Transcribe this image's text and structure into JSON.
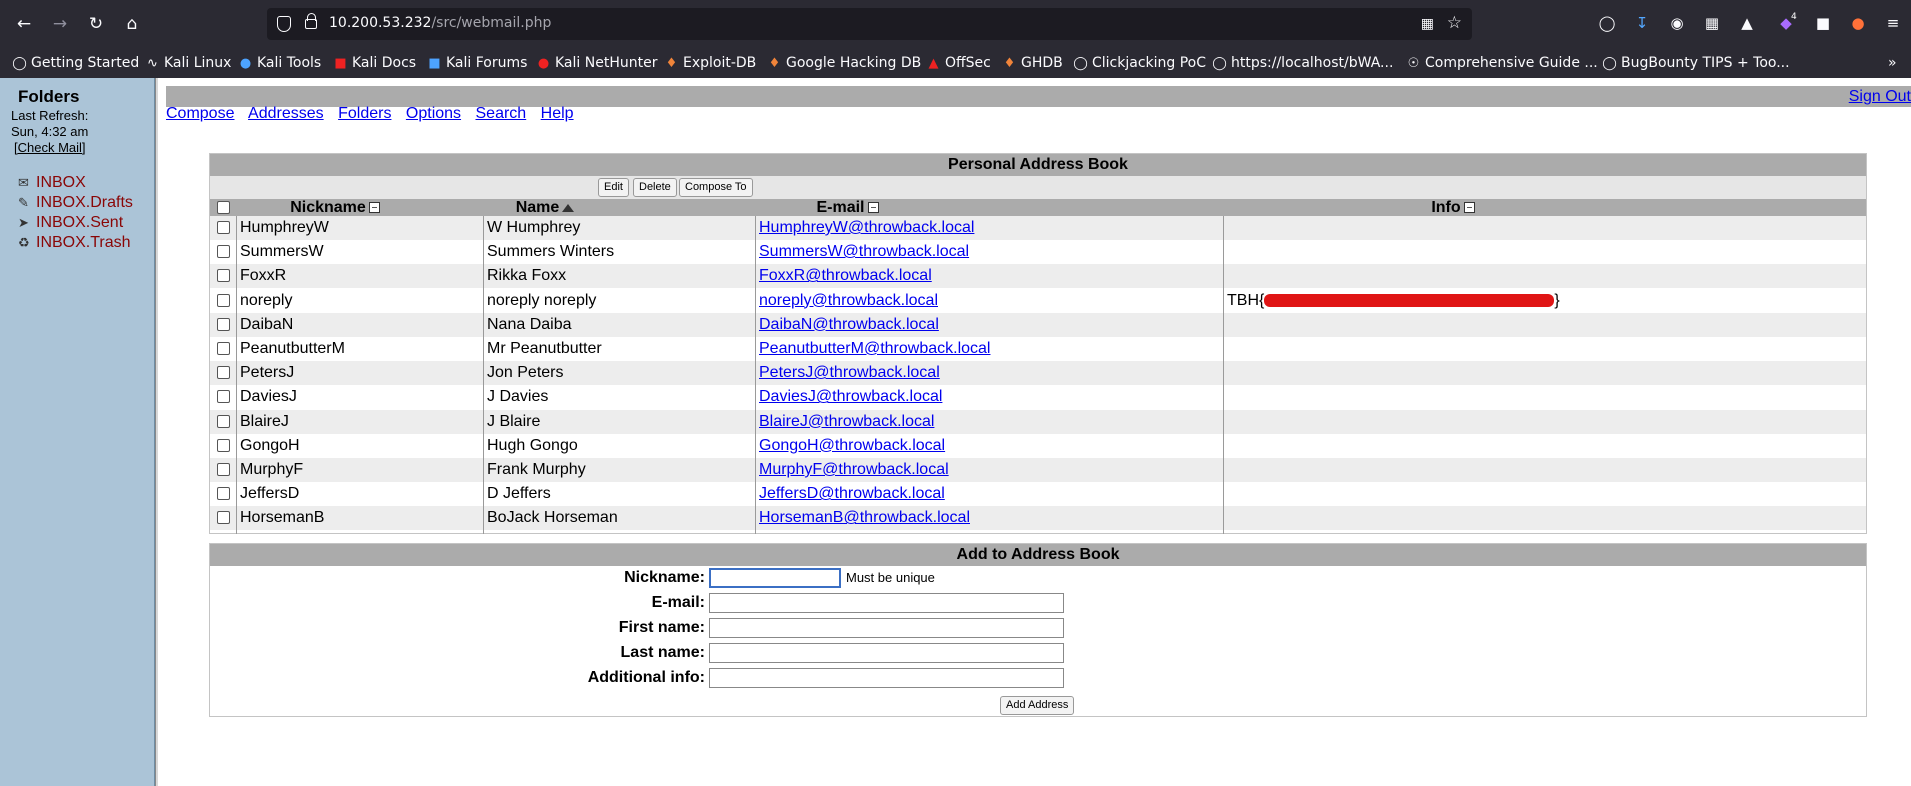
{
  "browser": {
    "url_host": "10.200.53.232",
    "url_path": "/src/webmail.php",
    "extension_badge": "4",
    "bookmarks": [
      {
        "label": "Getting Started",
        "icon": "globe-icon"
      },
      {
        "label": "Kali Linux",
        "icon": "kali-icon"
      },
      {
        "label": "Kali Tools",
        "icon": "kali-tools-icon"
      },
      {
        "label": "Kali Docs",
        "icon": "kali-docs-icon"
      },
      {
        "label": "Kali Forums",
        "icon": "kali-forums-icon"
      },
      {
        "label": "Kali NetHunter",
        "icon": "nethunter-icon"
      },
      {
        "label": "Exploit-DB",
        "icon": "exploitdb-icon"
      },
      {
        "label": "Google Hacking DB",
        "icon": "ghdb-icon"
      },
      {
        "label": "OffSec",
        "icon": "offsec-icon"
      },
      {
        "label": "GHDB",
        "icon": "ghdb-icon"
      },
      {
        "label": "Clickjacking PoC",
        "icon": "globe-icon"
      },
      {
        "label": "https://localhost/bWA...",
        "icon": "globe-icon"
      },
      {
        "label": "Comprehensive Guide ...",
        "icon": "wordpress-icon"
      },
      {
        "label": "BugBounty TIPS + Too...",
        "icon": "globe-icon"
      }
    ]
  },
  "sidebar": {
    "title": "Folders",
    "last_refresh_label": "Last Refresh:",
    "last_refresh_time": "Sun, 4:32 am",
    "check_mail": "[Check Mail]",
    "folders": [
      {
        "label": "INBOX",
        "icon": "inbox-icon"
      },
      {
        "label": "INBOX.Drafts",
        "icon": "drafts-icon"
      },
      {
        "label": "INBOX.Sent",
        "icon": "sent-icon"
      },
      {
        "label": "INBOX.Trash",
        "icon": "trash-icon"
      }
    ]
  },
  "header": {
    "sign_out": "Sign Out",
    "menu": [
      "Compose",
      "Addresses",
      "Folders",
      "Options",
      "Search",
      "Help"
    ]
  },
  "address_book": {
    "title": "Personal Address Book",
    "actions": [
      "Edit",
      "Delete",
      "Compose To"
    ],
    "columns": [
      "Nickname",
      "Name",
      "E-mail",
      "Info"
    ],
    "rows": [
      {
        "nickname": "HumphreyW",
        "name": "W Humphrey",
        "email": "HumphreyW@throwback.local",
        "info": ""
      },
      {
        "nickname": "SummersW",
        "name": "Summers Winters",
        "email": "SummersW@throwback.local",
        "info": ""
      },
      {
        "nickname": "FoxxR",
        "name": "Rikka Foxx",
        "email": "FoxxR@throwback.local",
        "info": ""
      },
      {
        "nickname": "noreply",
        "name": "noreply noreply",
        "email": "noreply@throwback.local",
        "info": "TBH{",
        "info_end": "}"
      },
      {
        "nickname": "DaibaN",
        "name": "Nana Daiba",
        "email": "DaibaN@throwback.local",
        "info": ""
      },
      {
        "nickname": "PeanutbutterM",
        "name": "Mr Peanutbutter",
        "email": "PeanutbutterM@throwback.local",
        "info": ""
      },
      {
        "nickname": "PetersJ",
        "name": "Jon Peters",
        "email": "PetersJ@throwback.local",
        "info": ""
      },
      {
        "nickname": "DaviesJ",
        "name": "J Davies",
        "email": "DaviesJ@throwback.local",
        "info": ""
      },
      {
        "nickname": "BlaireJ",
        "name": "J Blaire",
        "email": "BlaireJ@throwback.local",
        "info": ""
      },
      {
        "nickname": "GongoH",
        "name": "Hugh Gongo",
        "email": "GongoH@throwback.local",
        "info": ""
      },
      {
        "nickname": "MurphyF",
        "name": "Frank Murphy",
        "email": "MurphyF@throwback.local",
        "info": ""
      },
      {
        "nickname": "JeffersD",
        "name": "D Jeffers",
        "email": "JeffersD@throwback.local",
        "info": ""
      },
      {
        "nickname": "HorsemanB",
        "name": "BoJack Horseman",
        "email": "HorsemanB@throwback.local",
        "info": ""
      }
    ]
  },
  "add_form": {
    "title": "Add to Address Book",
    "nickname_label": "Nickname:",
    "nickname_hint": "Must be unique",
    "email_label": "E-mail:",
    "first_name_label": "First name:",
    "last_name_label": "Last name:",
    "info_label": "Additional info:",
    "submit": "Add Address",
    "nickname_value": "",
    "email_value": "",
    "first_name_value": "",
    "last_name_value": "",
    "info_value": ""
  },
  "colors": {
    "browser_chrome": "#2b2a33",
    "sidebar_bg": "#abc4d7",
    "folder_link": "#8a0606",
    "table_header": "#ababab",
    "link": "#0000ee",
    "redaction": "#e01515"
  }
}
